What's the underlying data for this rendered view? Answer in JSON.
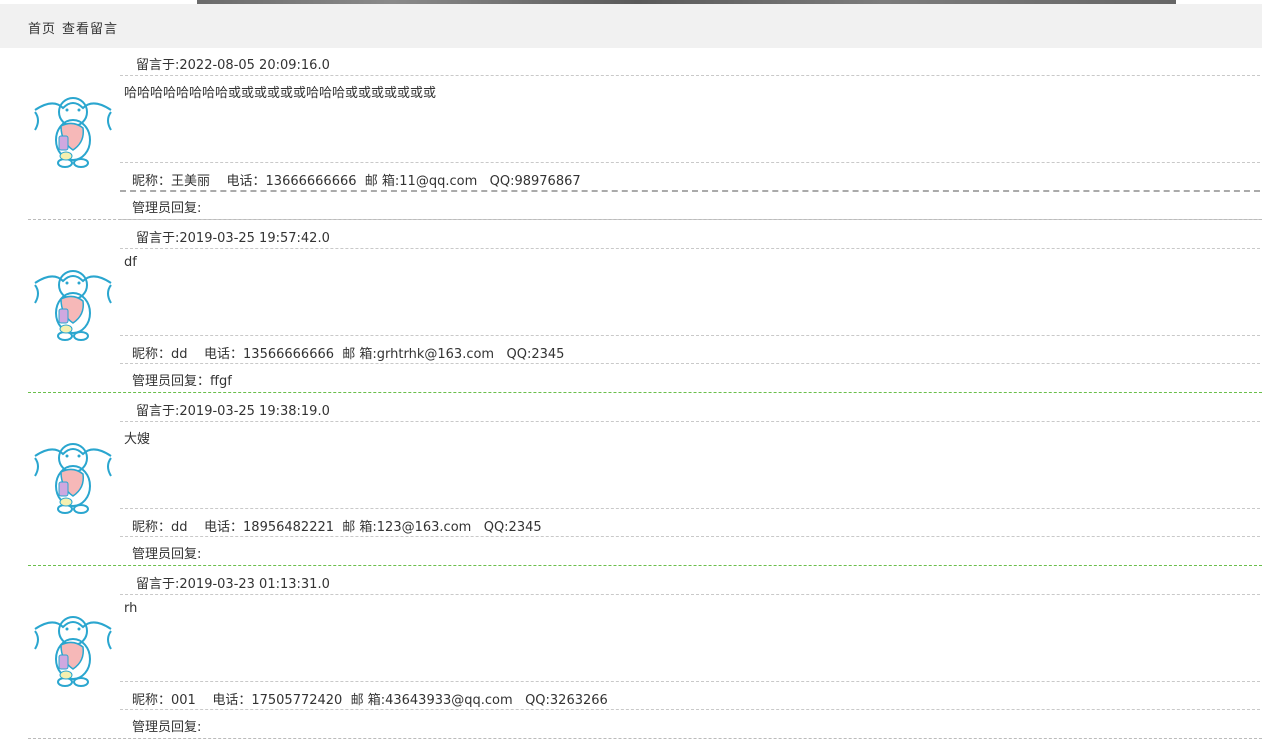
{
  "nav": {
    "home": "首页",
    "view": "查看留言"
  },
  "reply_prefix": "管理员回复:",
  "entries": [
    {
      "date": "留言于:2022-08-05 20:09:16.0",
      "content": "哈哈哈哈哈哈哈哈或或或或或或哈哈哈或或或或或或或",
      "info": "昵称：王美丽    电话：13666666666  邮 箱:11@qq.com   QQ:98976867",
      "reply": "管理员回复:"
    },
    {
      "date": "留言于:2019-03-25 19:57:42.0",
      "content": "df",
      "info": "昵称：dd    电话：13566666666  邮 箱:grhtrhk@163.com   QQ:2345",
      "reply": "管理员回复：ffgf"
    },
    {
      "date": "留言于:2019-03-25 19:38:19.0",
      "content": "大嫂",
      "info": "昵称：dd    电话：18956482221  邮 箱:123@163.com   QQ:2345",
      "reply": "管理员回复:"
    },
    {
      "date": "留言于:2019-03-23 01:13:31.0",
      "content": "rh",
      "info": "昵称：001    电话：17505772420  邮 箱:43643933@qq.com   QQ:3263266",
      "reply": "管理员回复:"
    }
  ],
  "colors": {
    "nav_bg": "#f1f1f1",
    "separator_green": "#6abf4b",
    "avatar_blue": "#2aa6cf",
    "avatar_pink": "#f6b8b8"
  }
}
